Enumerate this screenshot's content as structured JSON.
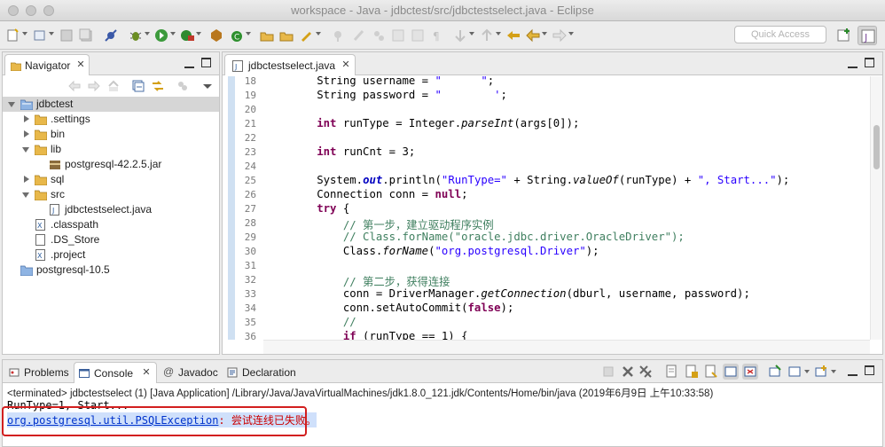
{
  "window": {
    "title": "workspace - Java - jdbctest/src/jdbctestselect.java - Eclipse"
  },
  "toolbar": {
    "quick_access_placeholder": "Quick Access"
  },
  "navigator": {
    "tab_label": "Navigator",
    "tree": [
      {
        "label": "jdbctest",
        "depth": 0,
        "type": "project",
        "expanded": true,
        "selected": true
      },
      {
        "label": ".settings",
        "depth": 1,
        "type": "folder",
        "expanded": false
      },
      {
        "label": "bin",
        "depth": 1,
        "type": "folder",
        "expanded": false
      },
      {
        "label": "lib",
        "depth": 1,
        "type": "folder",
        "expanded": true
      },
      {
        "label": "postgresql-42.2.5.jar",
        "depth": 2,
        "type": "jar"
      },
      {
        "label": "sql",
        "depth": 1,
        "type": "folder",
        "expanded": false
      },
      {
        "label": "src",
        "depth": 1,
        "type": "folder",
        "expanded": true
      },
      {
        "label": "jdbctestselect.java",
        "depth": 2,
        "type": "java"
      },
      {
        "label": ".classpath",
        "depth": 1,
        "type": "xml"
      },
      {
        "label": ".DS_Store",
        "depth": 1,
        "type": "file"
      },
      {
        "label": ".project",
        "depth": 1,
        "type": "xml"
      },
      {
        "label": "postgresql-10.5",
        "depth": 0,
        "type": "closed-project"
      }
    ]
  },
  "editor": {
    "tab_label": "jdbctestselect.java",
    "lines": [
      {
        "n": "18",
        "segs": [
          [
            "",
            "        String username = "
          ],
          [
            "str",
            "\"      \""
          ],
          [
            "",
            ";"
          ]
        ]
      },
      {
        "n": "19",
        "segs": [
          [
            "",
            "        String password = "
          ],
          [
            "str",
            "\"        '"
          ],
          [
            "",
            ";"
          ]
        ]
      },
      {
        "n": "20",
        "segs": []
      },
      {
        "n": "21",
        "segs": [
          [
            "kw",
            "        int"
          ],
          [
            "",
            " runType = Integer."
          ],
          [
            "it",
            "parseInt"
          ],
          [
            "",
            "(args[0]);"
          ]
        ]
      },
      {
        "n": "22",
        "segs": []
      },
      {
        "n": "23",
        "segs": [
          [
            "kw",
            "        int"
          ],
          [
            "",
            " runCnt = 3;"
          ]
        ]
      },
      {
        "n": "24",
        "segs": []
      },
      {
        "n": "25",
        "segs": [
          [
            "",
            "        System."
          ],
          [
            "fld",
            "out"
          ],
          [
            "",
            ".println("
          ],
          [
            "str",
            "\"RunType=\""
          ],
          [
            "",
            " + String."
          ],
          [
            "it",
            "valueOf"
          ],
          [
            "",
            "(runType) + "
          ],
          [
            "str",
            "\", Start...\""
          ],
          [
            "",
            ");"
          ]
        ]
      },
      {
        "n": "26",
        "segs": [
          [
            "",
            "        Connection conn = "
          ],
          [
            "kw",
            "null"
          ],
          [
            "",
            ";"
          ]
        ]
      },
      {
        "n": "27",
        "segs": [
          [
            "kw",
            "        try"
          ],
          [
            "",
            " {"
          ]
        ]
      },
      {
        "n": "28",
        "segs": [
          [
            "cmt",
            "            // 第一步，建立驱动程序实例"
          ]
        ]
      },
      {
        "n": "29",
        "segs": [
          [
            "cmt",
            "            // Class.forName(\"oracle.jdbc.driver.OracleDriver\");"
          ]
        ]
      },
      {
        "n": "30",
        "segs": [
          [
            "",
            "            Class."
          ],
          [
            "it",
            "forName"
          ],
          [
            "",
            "("
          ],
          [
            "str",
            "\"org.postgresql.Driver\""
          ],
          [
            "",
            ");"
          ]
        ]
      },
      {
        "n": "31",
        "segs": []
      },
      {
        "n": "32",
        "segs": [
          [
            "cmt",
            "            // 第二步，获得连接"
          ]
        ]
      },
      {
        "n": "33",
        "segs": [
          [
            "",
            "            conn = DriverManager."
          ],
          [
            "it",
            "getConnection"
          ],
          [
            "",
            "(dburl, username, password);"
          ]
        ]
      },
      {
        "n": "34",
        "segs": [
          [
            "",
            "            conn.setAutoCommit("
          ],
          [
            "kw",
            "false"
          ],
          [
            "",
            ");"
          ]
        ]
      },
      {
        "n": "35",
        "segs": [
          [
            "cmt",
            "            //"
          ]
        ]
      },
      {
        "n": "36",
        "segs": [
          [
            "kw",
            "            if"
          ],
          [
            "",
            " (runType == 1) {"
          ]
        ]
      }
    ]
  },
  "console_view": {
    "tabs": [
      {
        "label": "Problems",
        "active": false
      },
      {
        "label": "Console",
        "active": true
      },
      {
        "label": "Javadoc",
        "active": false
      },
      {
        "label": "Declaration",
        "active": false
      }
    ],
    "status": "<terminated> jdbctestselect (1) [Java Application] /Library/Java/JavaVirtualMachines/jdk1.8.0_121.jdk/Contents/Home/bin/java (2019年6月9日 上午10:33:58)",
    "output_line": "RunType=1, Start...",
    "error_exception": "org.postgresql.util.PSQLException",
    "error_message": ": 尝试连线已失败。"
  },
  "colors": {
    "keyword": "#7f0055",
    "string": "#2a00ff",
    "comment": "#3f7f5f",
    "field": "#0000c0",
    "error": "#cc0000",
    "highlight_border": "#d21f1f"
  }
}
